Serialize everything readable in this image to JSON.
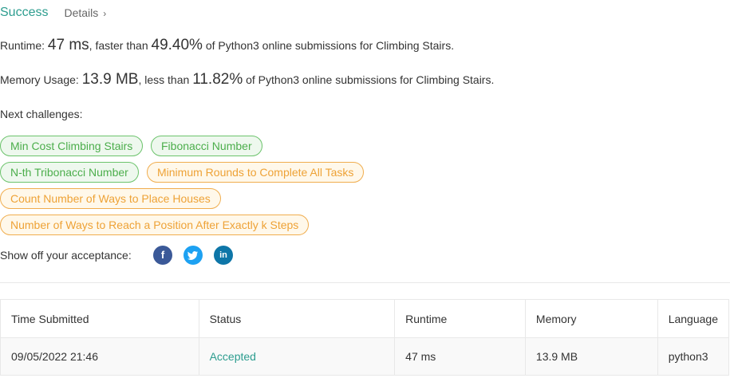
{
  "header": {
    "status": "Success",
    "details_label": "Details",
    "details_chevron": "›"
  },
  "runtime": {
    "label": "Runtime:",
    "value": "47 ms",
    "middle": ", faster than",
    "percent": "49.40%",
    "suffix": "of Python3 online submissions for Climbing Stairs."
  },
  "memory": {
    "label": "Memory Usage:",
    "value": "13.9 MB",
    "middle": ", less than",
    "percent": "11.82%",
    "suffix": "of Python3 online submissions for Climbing Stairs."
  },
  "next_challenges": {
    "label": "Next challenges:",
    "items": [
      {
        "label": "Min Cost Climbing Stairs",
        "difficulty": "easy"
      },
      {
        "label": "Fibonacci Number",
        "difficulty": "easy"
      },
      {
        "label": "N-th Tribonacci Number",
        "difficulty": "easy"
      },
      {
        "label": "Minimum Rounds to Complete All Tasks",
        "difficulty": "medium"
      },
      {
        "label": "Count Number of Ways to Place Houses",
        "difficulty": "medium"
      },
      {
        "label": "Number of Ways to Reach a Position After Exactly k Steps",
        "difficulty": "medium"
      }
    ]
  },
  "share": {
    "label": "Show off your acceptance:",
    "icons": [
      "facebook-icon",
      "twitter-icon",
      "linkedin-icon"
    ]
  },
  "table": {
    "headers": [
      "Time Submitted",
      "Status",
      "Runtime",
      "Memory",
      "Language"
    ],
    "rows": [
      [
        "09/05/2022 21:46",
        "Accepted",
        "47 ms",
        "13.9 MB",
        "python3"
      ]
    ]
  },
  "colors": {
    "success": "#2d9d8f",
    "easy": "#4cae4c",
    "medium": "#eea236"
  }
}
